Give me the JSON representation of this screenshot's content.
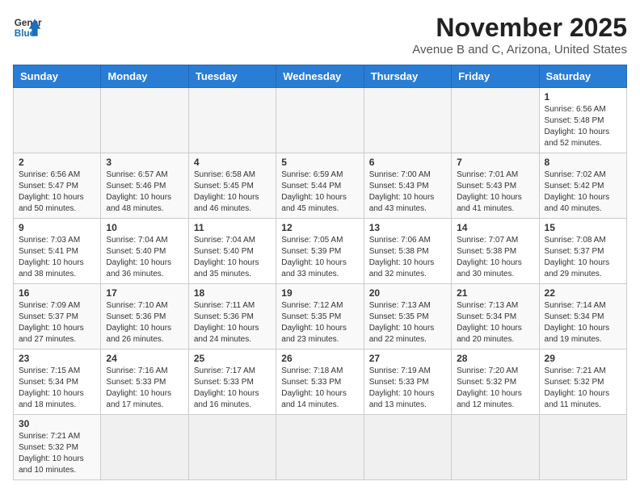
{
  "header": {
    "logo_line1": "General",
    "logo_line2": "Blue",
    "month": "November 2025",
    "location": "Avenue B and C, Arizona, United States"
  },
  "days_of_week": [
    "Sunday",
    "Monday",
    "Tuesday",
    "Wednesday",
    "Thursday",
    "Friday",
    "Saturday"
  ],
  "weeks": [
    [
      {
        "day": "",
        "info": ""
      },
      {
        "day": "",
        "info": ""
      },
      {
        "day": "",
        "info": ""
      },
      {
        "day": "",
        "info": ""
      },
      {
        "day": "",
        "info": ""
      },
      {
        "day": "",
        "info": ""
      },
      {
        "day": "1",
        "info": "Sunrise: 6:56 AM\nSunset: 5:48 PM\nDaylight: 10 hours and 52 minutes."
      }
    ],
    [
      {
        "day": "2",
        "info": "Sunrise: 6:56 AM\nSunset: 5:47 PM\nDaylight: 10 hours and 50 minutes."
      },
      {
        "day": "3",
        "info": "Sunrise: 6:57 AM\nSunset: 5:46 PM\nDaylight: 10 hours and 48 minutes."
      },
      {
        "day": "4",
        "info": "Sunrise: 6:58 AM\nSunset: 5:45 PM\nDaylight: 10 hours and 46 minutes."
      },
      {
        "day": "5",
        "info": "Sunrise: 6:59 AM\nSunset: 5:44 PM\nDaylight: 10 hours and 45 minutes."
      },
      {
        "day": "6",
        "info": "Sunrise: 7:00 AM\nSunset: 5:43 PM\nDaylight: 10 hours and 43 minutes."
      },
      {
        "day": "7",
        "info": "Sunrise: 7:01 AM\nSunset: 5:43 PM\nDaylight: 10 hours and 41 minutes."
      },
      {
        "day": "8",
        "info": "Sunrise: 7:02 AM\nSunset: 5:42 PM\nDaylight: 10 hours and 40 minutes."
      }
    ],
    [
      {
        "day": "9",
        "info": "Sunrise: 7:03 AM\nSunset: 5:41 PM\nDaylight: 10 hours and 38 minutes."
      },
      {
        "day": "10",
        "info": "Sunrise: 7:04 AM\nSunset: 5:40 PM\nDaylight: 10 hours and 36 minutes."
      },
      {
        "day": "11",
        "info": "Sunrise: 7:04 AM\nSunset: 5:40 PM\nDaylight: 10 hours and 35 minutes."
      },
      {
        "day": "12",
        "info": "Sunrise: 7:05 AM\nSunset: 5:39 PM\nDaylight: 10 hours and 33 minutes."
      },
      {
        "day": "13",
        "info": "Sunrise: 7:06 AM\nSunset: 5:38 PM\nDaylight: 10 hours and 32 minutes."
      },
      {
        "day": "14",
        "info": "Sunrise: 7:07 AM\nSunset: 5:38 PM\nDaylight: 10 hours and 30 minutes."
      },
      {
        "day": "15",
        "info": "Sunrise: 7:08 AM\nSunset: 5:37 PM\nDaylight: 10 hours and 29 minutes."
      }
    ],
    [
      {
        "day": "16",
        "info": "Sunrise: 7:09 AM\nSunset: 5:37 PM\nDaylight: 10 hours and 27 minutes."
      },
      {
        "day": "17",
        "info": "Sunrise: 7:10 AM\nSunset: 5:36 PM\nDaylight: 10 hours and 26 minutes."
      },
      {
        "day": "18",
        "info": "Sunrise: 7:11 AM\nSunset: 5:36 PM\nDaylight: 10 hours and 24 minutes."
      },
      {
        "day": "19",
        "info": "Sunrise: 7:12 AM\nSunset: 5:35 PM\nDaylight: 10 hours and 23 minutes."
      },
      {
        "day": "20",
        "info": "Sunrise: 7:13 AM\nSunset: 5:35 PM\nDaylight: 10 hours and 22 minutes."
      },
      {
        "day": "21",
        "info": "Sunrise: 7:13 AM\nSunset: 5:34 PM\nDaylight: 10 hours and 20 minutes."
      },
      {
        "day": "22",
        "info": "Sunrise: 7:14 AM\nSunset: 5:34 PM\nDaylight: 10 hours and 19 minutes."
      }
    ],
    [
      {
        "day": "23",
        "info": "Sunrise: 7:15 AM\nSunset: 5:34 PM\nDaylight: 10 hours and 18 minutes."
      },
      {
        "day": "24",
        "info": "Sunrise: 7:16 AM\nSunset: 5:33 PM\nDaylight: 10 hours and 17 minutes."
      },
      {
        "day": "25",
        "info": "Sunrise: 7:17 AM\nSunset: 5:33 PM\nDaylight: 10 hours and 16 minutes."
      },
      {
        "day": "26",
        "info": "Sunrise: 7:18 AM\nSunset: 5:33 PM\nDaylight: 10 hours and 14 minutes."
      },
      {
        "day": "27",
        "info": "Sunrise: 7:19 AM\nSunset: 5:33 PM\nDaylight: 10 hours and 13 minutes."
      },
      {
        "day": "28",
        "info": "Sunrise: 7:20 AM\nSunset: 5:32 PM\nDaylight: 10 hours and 12 minutes."
      },
      {
        "day": "29",
        "info": "Sunrise: 7:21 AM\nSunset: 5:32 PM\nDaylight: 10 hours and 11 minutes."
      }
    ],
    [
      {
        "day": "30",
        "info": "Sunrise: 7:21 AM\nSunset: 5:32 PM\nDaylight: 10 hours and 10 minutes."
      },
      {
        "day": "",
        "info": ""
      },
      {
        "day": "",
        "info": ""
      },
      {
        "day": "",
        "info": ""
      },
      {
        "day": "",
        "info": ""
      },
      {
        "day": "",
        "info": ""
      },
      {
        "day": "",
        "info": ""
      }
    ]
  ]
}
